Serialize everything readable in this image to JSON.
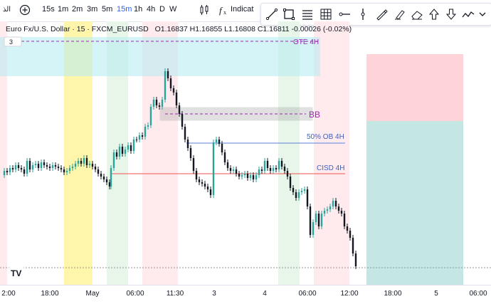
{
  "toolbar": {
    "left_text": "الذ",
    "timeframes": [
      "15s",
      "1m",
      "2m",
      "3m",
      "5m",
      "15m",
      "1h",
      "4h",
      "D",
      "W"
    ],
    "active_timeframe": "15m",
    "indicators_label": "Indicat"
  },
  "draw_tools": [
    "line-tool-icon",
    "rectangle-tool-icon",
    "fib-tool-icon",
    "grid-tool-icon",
    "horizontal-ray-icon",
    "vertical-line-icon",
    "brush-icon",
    "highlighter-icon",
    "eraser-icon",
    "arrow-up-icon",
    "arrow-down-icon",
    "path-icon",
    "more-icon"
  ],
  "legend": {
    "symbol": "Euro Fx/U.S. Dollar · 15 · FXCM_EURUSD",
    "ohlc": "O1.16837 H1.16855 L1.16808 C1.16811 -0.00026 (-0.02%)",
    "collapsed_count": "3"
  },
  "annotations": {
    "ote": "OTE 4H",
    "bb": "BB",
    "ob": "50% OB 4H",
    "cisd": "CISD 4H"
  },
  "time_axis": [
    "2:00",
    "18:00",
    "May",
    "06:00",
    "11:30",
    "3",
    "4",
    "06:00",
    "12:00",
    "18:00",
    "5",
    "06:00"
  ],
  "colors": {
    "up": "#26a69a",
    "down": "#131722",
    "ote_box": "#b2ebf2",
    "yellow_zone": "#fff59d",
    "green_zone": "#c8e6c9",
    "red_zone": "#ffcdd2",
    "ob_line": "#5b7fd6",
    "cisd_line": "#ef5350",
    "bb_box": "#9e9e9e",
    "dashed_purple": "#9c27b0",
    "accent": "#2962ff"
  },
  "logo": "TV"
}
